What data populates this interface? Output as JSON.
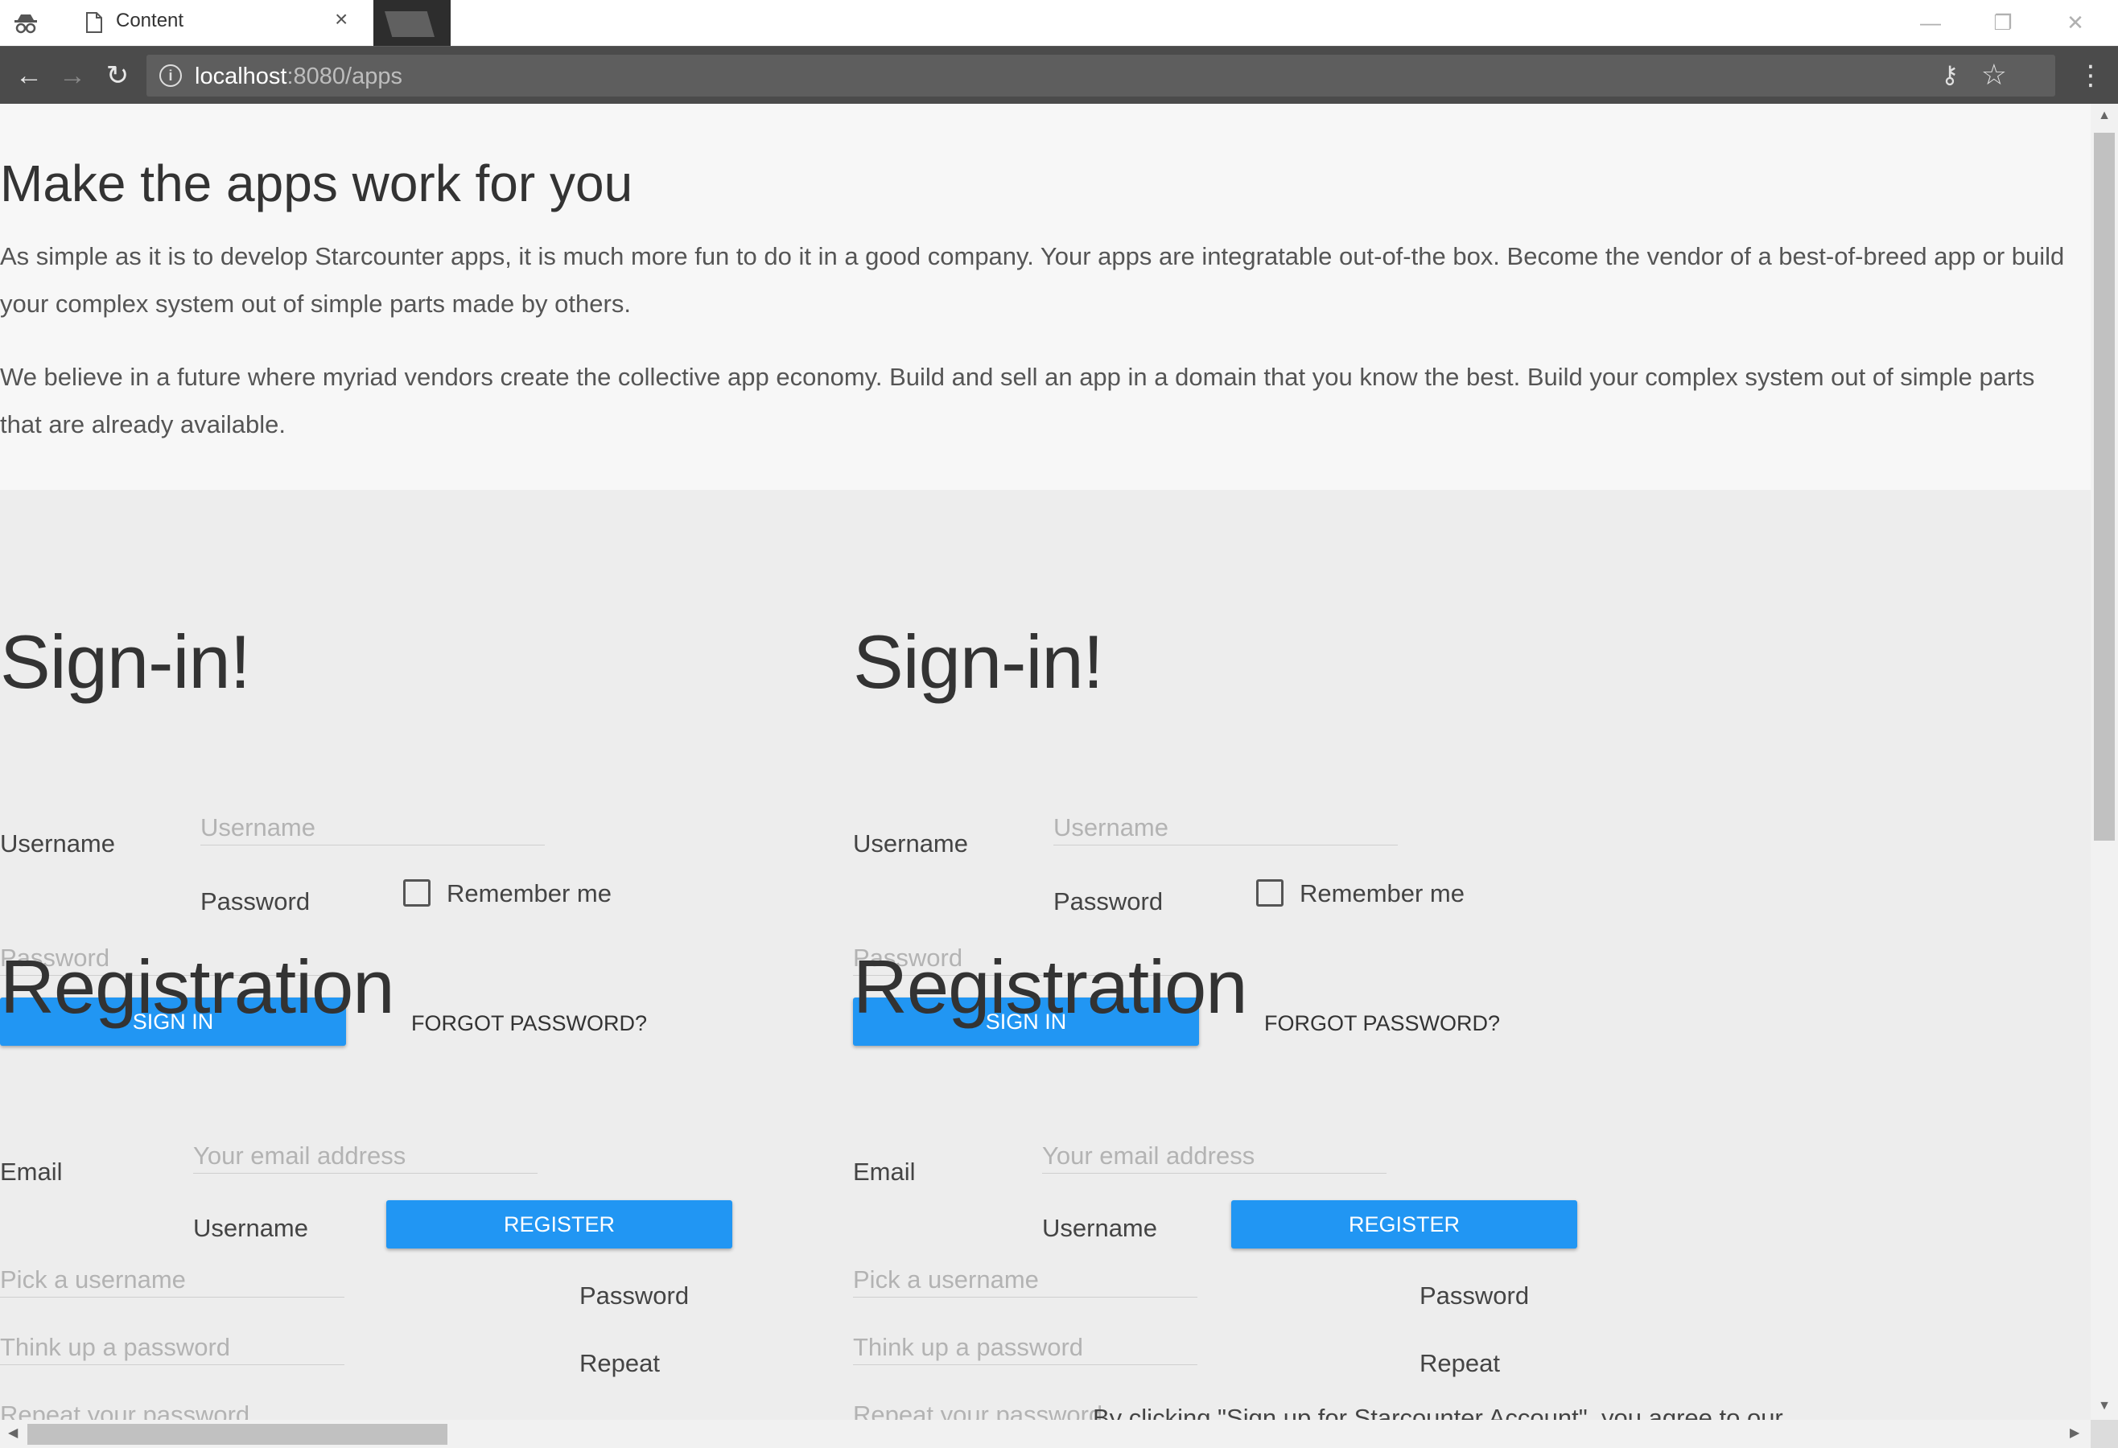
{
  "browser": {
    "tab_title": "Content",
    "url_host": "localhost",
    "url_path": ":8080/apps"
  },
  "intro": {
    "heading": "Make the apps work for you",
    "paragraph1": "As simple as it is to develop Starcounter apps, it is much more fun to do it in a good company. Your apps are integratable out-of-the box. Become the vendor of a best-of-breed app or build your complex system out of simple parts made by others.",
    "paragraph2": "We believe in a future where myriad vendors create the collective app economy. Build and sell an app in a domain that you know the best. Build your complex system out of simple parts that are already available."
  },
  "signin": {
    "heading": "Sign-in!",
    "username_label": "Username",
    "username_placeholder": "Username",
    "password_label": "Password",
    "password_placeholder": "Password",
    "remember_label": "Remember me",
    "remember_checked": false,
    "signin_button": "SIGN IN",
    "forgot_link": "FORGOT PASSWORD?"
  },
  "registration": {
    "heading": "Registration",
    "email_label": "Email",
    "email_placeholder": "Your email address",
    "username_label": "Username",
    "register_button": "REGISTER",
    "username_placeholder": "Pick a username",
    "password_label": "Password",
    "password_placeholder": "Think up a password",
    "repeat_label": "Repeat",
    "repeat_placeholder": "Repeat your password"
  },
  "terms_text": "By clicking \"Sign up for Starcounter Account\", you agree to our",
  "colors": {
    "primary_button": "#2196f3",
    "toolbar": "#4b4b4b",
    "page_bg": "#ededed"
  }
}
